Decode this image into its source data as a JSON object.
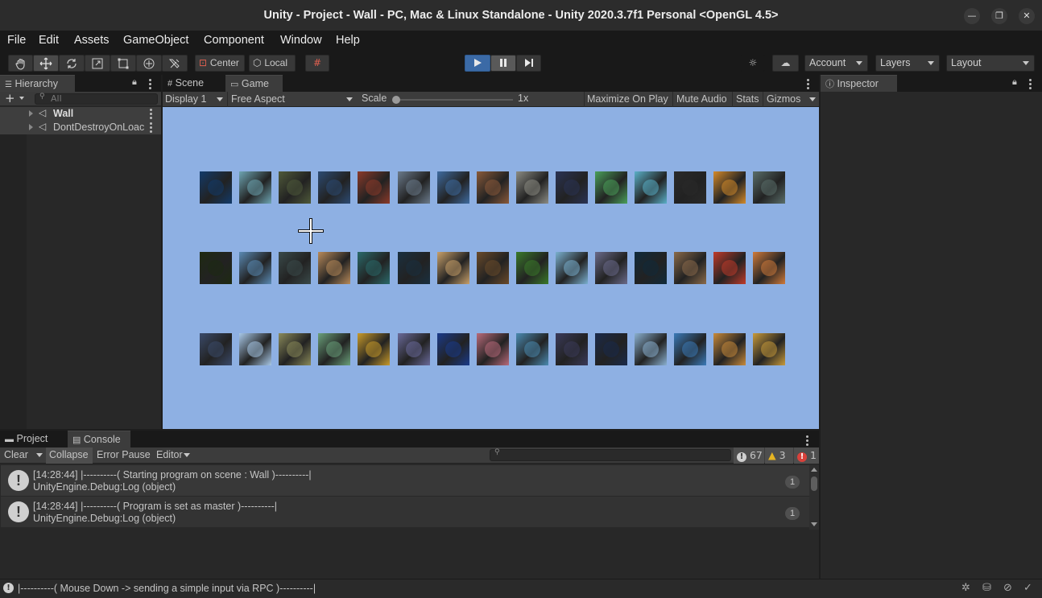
{
  "window": {
    "title": "Unity - Project - Wall - PC, Mac & Linux Standalone - Unity 2020.3.7f1 Personal <OpenGL 4.5>",
    "controls": [
      "—",
      "❐",
      "✕"
    ]
  },
  "menu": [
    "File",
    "Edit",
    "Assets",
    "GameObject",
    "Component",
    "Window",
    "Help"
  ],
  "toolbar": {
    "pivot_label": "Center",
    "space_label": "Local",
    "account_label": "Account",
    "layers_label": "Layers",
    "layout_label": "Layout"
  },
  "hierarchy": {
    "tab_label": "Hierarchy",
    "search_placeholder": "All",
    "items": [
      "Wall",
      "DontDestroyOnLoac"
    ]
  },
  "center": {
    "tabs": [
      "Scene",
      "Game"
    ],
    "display_label": "Display 1",
    "aspect_label": "Free Aspect",
    "scale_label": "Scale",
    "scale_value": "1x",
    "buttons": [
      "Maximize On Play",
      "Mute Audio",
      "Stats",
      "Gizmos"
    ]
  },
  "inspector": {
    "tab_label": "Inspector"
  },
  "game": {
    "rows": [
      [
        "#123a6a",
        "#6ea5b3",
        "#4f5a3a",
        "#2c4b73",
        "#8c3a2a",
        "#6b7b8c",
        "#3e6ba0",
        "#8a5a3a",
        "#8c8c84",
        "#2a3354",
        "#4aa05a",
        "#5ab0c8",
        "#2a2a2a",
        "#d48a2a",
        "#5a6e6a"
      ],
      [
        "#1e2a12",
        "#5a8ab4",
        "#3a4a4a",
        "#b88a5a",
        "#2a6a6a",
        "#1a3040",
        "#c8a06a",
        "#6a4a2a",
        "#3a7a2a",
        "#7ab0d0",
        "#6a6a8a",
        "#102a3a",
        "#8a6a4a",
        "#c03a2a",
        "#d07a3a"
      ],
      [
        "#3a4a6a",
        "#a8c8e8",
        "#8a8a5a",
        "#6aa07a",
        "#c89a2a",
        "#6a6a9a",
        "#1a3a8a",
        "#b86a7a",
        "#4a8ab0",
        "#3a3a5a",
        "#1a2a4a",
        "#8ab0d0",
        "#3a7ab8",
        "#c88a3a",
        "#c89a3a"
      ]
    ]
  },
  "console": {
    "tabs": [
      "Project",
      "Console"
    ],
    "buttons": [
      "Clear",
      "Collapse",
      "Error Pause",
      "Editor"
    ],
    "counts": {
      "info": "67",
      "warn": "3",
      "error": "1"
    },
    "entries": [
      {
        "line1": "[14:28:44] |----------( Starting program on scene : Wall )----------|",
        "line2": "UnityEngine.Debug:Log (object)",
        "count": "1"
      },
      {
        "line1": "[14:28:44] |----------( Program is set as master )----------|",
        "line2": "UnityEngine.Debug:Log (object)",
        "count": "1"
      }
    ]
  },
  "status": {
    "message": "|----------( Mouse Down -> sending a simple input via RPC )----------|"
  }
}
